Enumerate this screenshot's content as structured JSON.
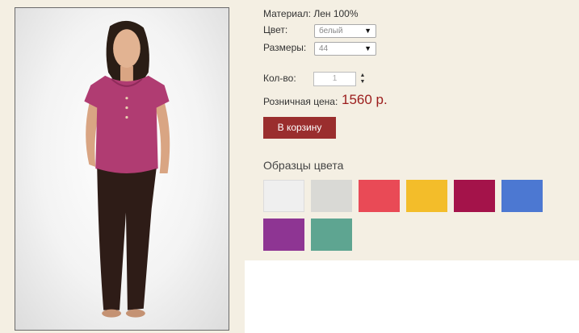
{
  "product": {
    "material_label": "Материал:",
    "material_value": "Лен 100%",
    "color_label": "Цвет:",
    "color_value": "белый",
    "size_label": "Размеры:",
    "size_value": "44",
    "qty_label": "Кол-во:",
    "qty_value": "1",
    "price_label": "Розничная цена:",
    "price_value": "1560 р.",
    "add_to_cart_label": "В корзину"
  },
  "swatches": {
    "title": "Образцы цвета",
    "items": [
      {
        "name": "white",
        "color": "#efefef"
      },
      {
        "name": "light-gray",
        "color": "#d9d9d5"
      },
      {
        "name": "coral-red",
        "color": "#e94a56"
      },
      {
        "name": "yellow",
        "color": "#f3bd2a"
      },
      {
        "name": "crimson",
        "color": "#a4134a"
      },
      {
        "name": "blue",
        "color": "#4c78d2"
      },
      {
        "name": "purple",
        "color": "#8e3593"
      },
      {
        "name": "teal",
        "color": "#5ea591"
      }
    ]
  },
  "icons": {
    "select_arrow": "▼",
    "spinner_up": "▲",
    "spinner_down": "▼"
  }
}
